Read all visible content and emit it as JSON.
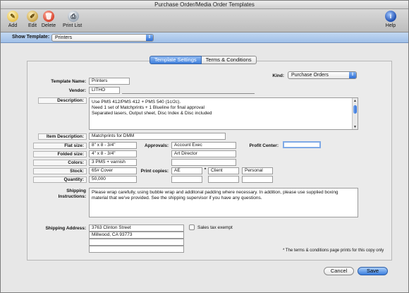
{
  "window": {
    "title": "Purchase Order/Media Order Templates"
  },
  "toolbar": {
    "add": "Add",
    "edit": "Edit",
    "delete": "Delete",
    "print_list": "Print List",
    "help": "Help"
  },
  "show_template": {
    "label": "Show Template:",
    "value": "Printers"
  },
  "tabs": [
    "Template Settings",
    "Terms & Conditions"
  ],
  "form": {
    "template_name_label": "Template Name:",
    "template_name": "Printers",
    "kind_label": "Kind:",
    "kind": "Purchase Orders",
    "vendor_label": "Vendor:",
    "vendor": "LITHO",
    "description_label": "Description:",
    "description_lines": [
      "Use PMS 412/PMS 412 + PMS 540 (1c/2c).",
      "Need 1 set of Matchprints + 1 Blueline for final approval",
      "Separated lasers, Output sheet, Disc Index & Disc included"
    ],
    "item_description_label": "Item Description:",
    "item_description": "Matchprints for DMM",
    "flat_size_label": "Flat size:",
    "flat_size": "8\" x 8 - 3/4\"",
    "folded_size_label": "Folded size:",
    "folded_size": "4\" x 8 - 3/4\"",
    "colors_label": "Colors:",
    "colors": "3 PMS + varnish",
    "stock_label": "Stock:",
    "stock": "65# Cover",
    "quantity_label": "Quantity:",
    "quantity": "50,000",
    "approvals_label": "Approvals:",
    "approvals": [
      "Account Exec",
      "Art Director",
      ""
    ],
    "profit_center_label": "Profit Center:",
    "profit_center": "",
    "print_copies_label": "Print copies:",
    "print_copies": [
      "AE",
      "Client",
      "Personal"
    ],
    "print_copies_star": "*",
    "shipping_instructions_label_1": "Shipping",
    "shipping_instructions_label_2": "Instructions:",
    "shipping_instructions_lines": [
      "Please wrap carefully, using bubble wrap and additonal padding where necessary. In addition, please use supplied boxing",
      "material that we've provided. See the shipping supervisor if you have any questions."
    ],
    "shipping_address_label": "Shipping Address:",
    "shipping_address": [
      "3763 Clinton Street",
      "Millwood, CA 93773",
      "",
      ""
    ],
    "sales_tax_exempt_label": "Sales tax exempt",
    "footnote": "* The terms & conditions page prints for this copy only"
  },
  "buttons": {
    "cancel": "Cancel",
    "save": "Save"
  },
  "colors": {
    "accent": "#3f7fdc",
    "showbar": "#b0cbee",
    "delete": "#d9442e"
  }
}
